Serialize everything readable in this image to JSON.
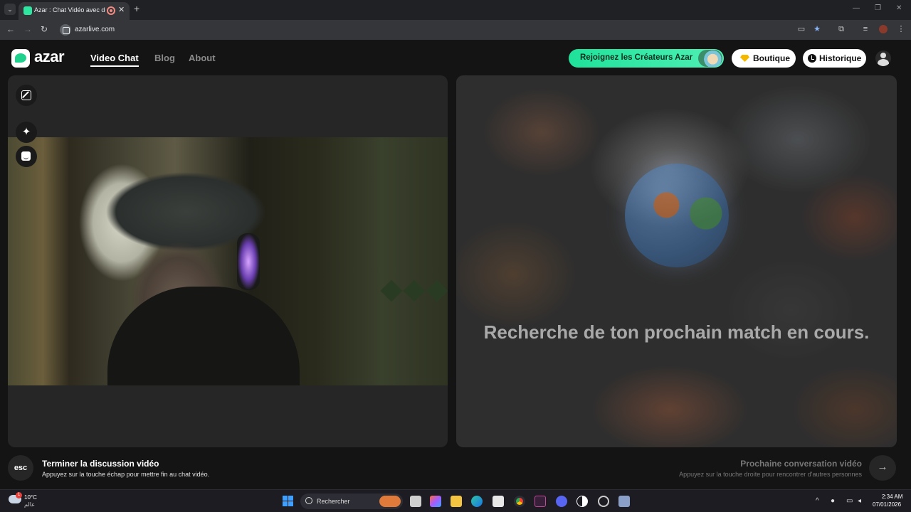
{
  "browser": {
    "tab_title": "Azar : Chat Vidéo avec de n",
    "url": "azarlive.com"
  },
  "header": {
    "logo_text": "azar",
    "nav": [
      {
        "label": "Video Chat"
      },
      {
        "label": "Blog"
      },
      {
        "label": "About"
      }
    ],
    "creators_button": "Rejoignez les Créateurs Azar",
    "boutique_button": "Boutique",
    "history_button": "Historique"
  },
  "left_panel": {
    "tools": [
      "expand-icon",
      "sparkle-icon",
      "face-icon"
    ]
  },
  "right_panel": {
    "status_text": "Recherche de ton prochain match en cours."
  },
  "footer": {
    "esc_key": "esc",
    "end_title": "Terminer la discussion vidéo",
    "end_subtitle": "Appuyez sur la touche échap pour mettre fin au chat vidéo.",
    "next_title": "Prochaine conversation vidéo",
    "next_subtitle": "Appuyez sur la touche droite pour rencontrer d'autres personnes",
    "next_arrow": "→"
  },
  "taskbar": {
    "weather_temp": "10°C",
    "weather_location": "عالم",
    "weather_badge": "1",
    "search_placeholder": "Rechercher",
    "time": "2:34 AM",
    "date": "07/01/2026"
  },
  "colors": {
    "accent": "#1fe29a",
    "page_bg": "#141414",
    "panel_bg": "#262626"
  }
}
